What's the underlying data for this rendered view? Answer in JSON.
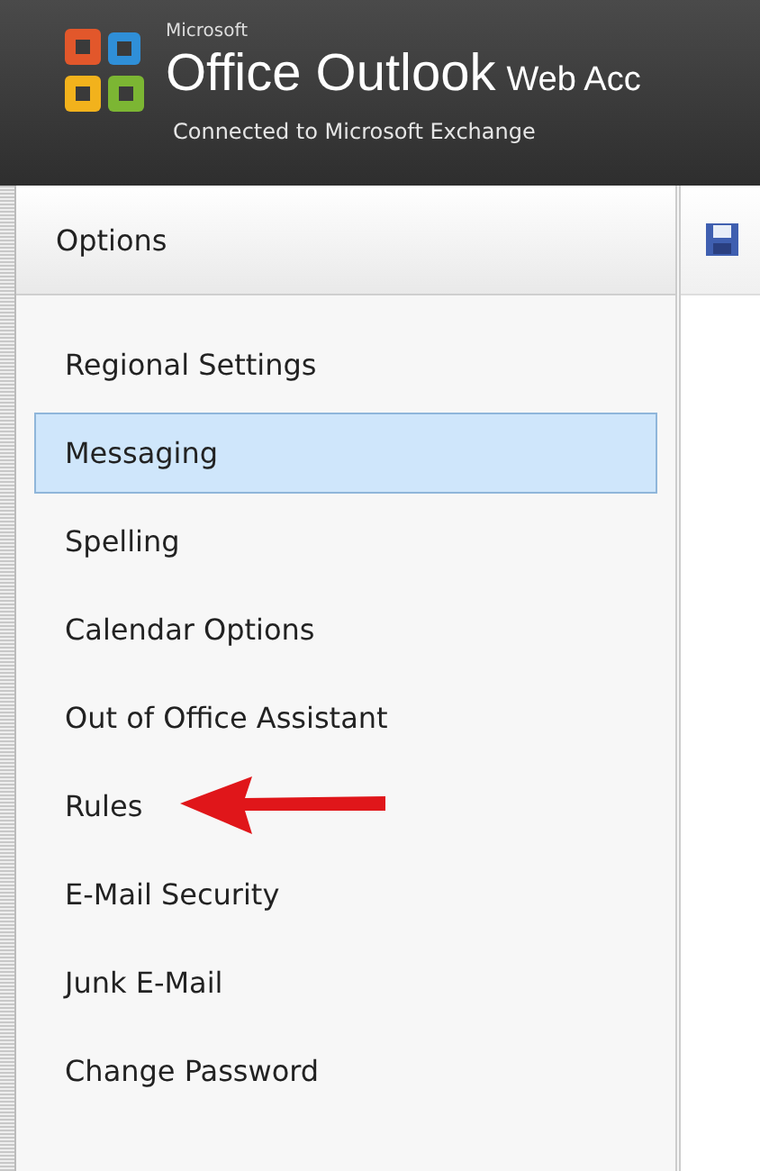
{
  "header": {
    "brand_small": "Microsoft",
    "product": "Office Outlook",
    "product_suffix": "Web Acc",
    "subtitle": "Connected to Microsoft Exchange"
  },
  "sidebar": {
    "title": "Options",
    "items": [
      {
        "label": "Regional Settings",
        "selected": false,
        "arrow": false
      },
      {
        "label": "Messaging",
        "selected": true,
        "arrow": false
      },
      {
        "label": "Spelling",
        "selected": false,
        "arrow": false
      },
      {
        "label": "Calendar Options",
        "selected": false,
        "arrow": false
      },
      {
        "label": "Out of Office Assistant",
        "selected": false,
        "arrow": false
      },
      {
        "label": "Rules",
        "selected": false,
        "arrow": true
      },
      {
        "label": "E-Mail Security",
        "selected": false,
        "arrow": false
      },
      {
        "label": "Junk E-Mail",
        "selected": false,
        "arrow": false
      },
      {
        "label": "Change Password",
        "selected": false,
        "arrow": false
      }
    ]
  }
}
